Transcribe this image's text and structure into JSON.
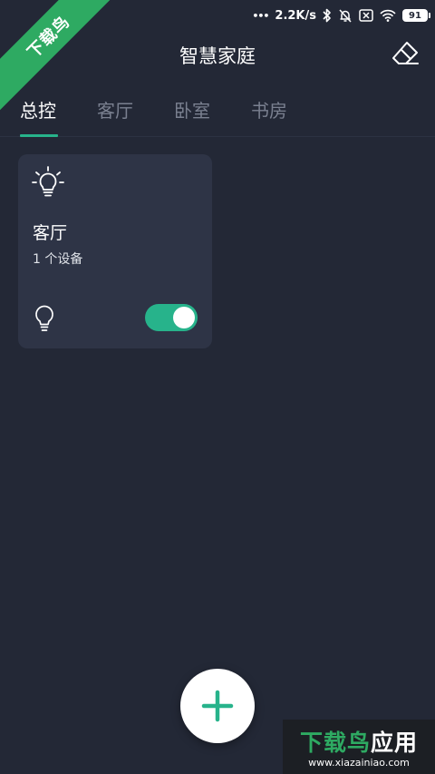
{
  "status_bar": {
    "network_speed": "2.2K/s",
    "battery_level": "91",
    "dots": "•••",
    "icons": [
      "bluetooth-icon",
      "mute-bell-icon",
      "sim-x-icon",
      "wifi-icon",
      "battery-icon"
    ]
  },
  "watermark": {
    "ribbon_text": "下载鸟",
    "brand_name_green": "下载鸟",
    "brand_name_white": "应用",
    "brand_url": "www.xiazainiao.com"
  },
  "header": {
    "title": "智慧家庭",
    "left_icon": "menu-icon",
    "right_icon": "eraser-icon"
  },
  "tabs": [
    {
      "label": "总控",
      "active": true
    },
    {
      "label": "客厅",
      "active": false
    },
    {
      "label": "卧室",
      "active": false
    },
    {
      "label": "书房",
      "active": false
    }
  ],
  "devices": [
    {
      "room": "客厅",
      "count_text": "1 个设备",
      "switch_on": true,
      "icon_top": "lightbulb-glow-icon",
      "icon_bottom": "lightbulb-icon"
    }
  ],
  "fab": {
    "icon": "plus-icon"
  },
  "colors": {
    "background": "#232836",
    "card": "#2e3446",
    "accent": "#27b38b",
    "tab_inactive": "#7a8090",
    "watermark_green": "#2eaa62"
  }
}
